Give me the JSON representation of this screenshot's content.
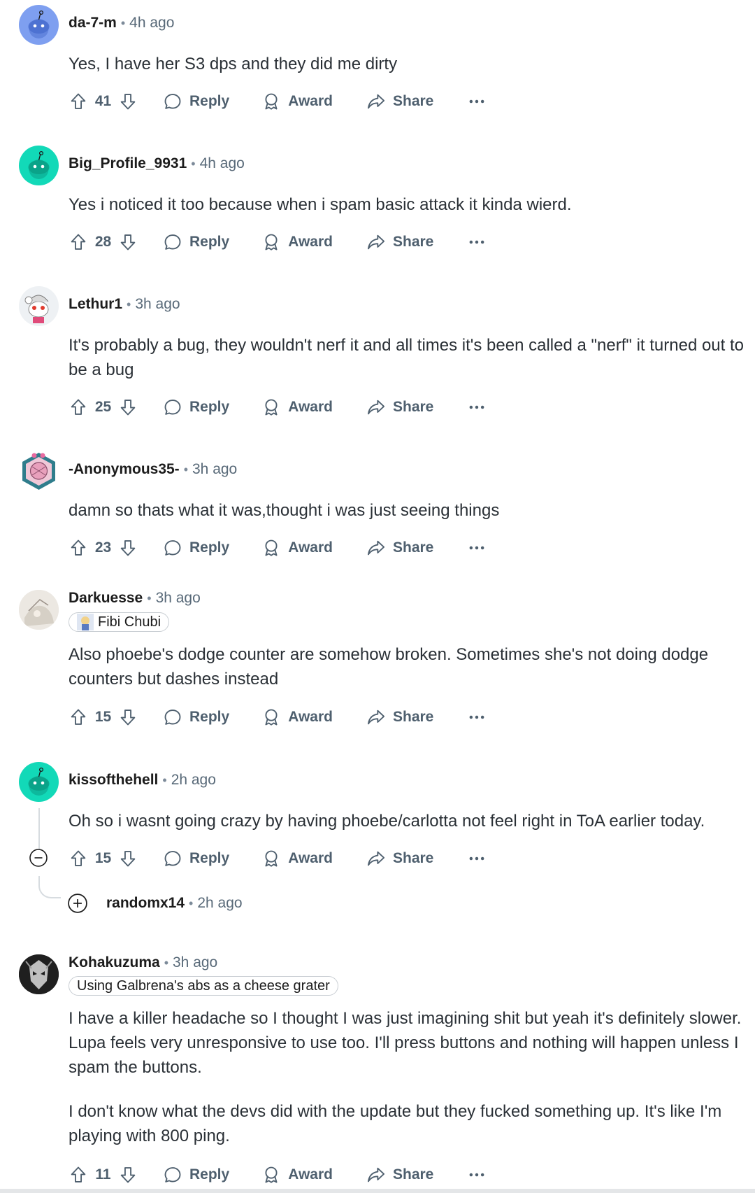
{
  "action_labels": {
    "reply": "Reply",
    "award": "Award",
    "share": "Share"
  },
  "comments": [
    {
      "author": "da-7-m",
      "time": "4h ago",
      "flair": "",
      "body": [
        "Yes, I have her S3 dps and they did me dirty"
      ],
      "votes": "41",
      "avatar": "reddit-default-blue-avatar"
    },
    {
      "author": "Big_Profile_9931",
      "time": "4h ago",
      "flair": "",
      "body": [
        "Yes i noticed it too because when i spam basic attack it kinda wierd."
      ],
      "votes": "28",
      "avatar": "reddit-default-teal-avatar"
    },
    {
      "author": "Lethur1",
      "time": "3h ago",
      "flair": "",
      "body": [
        "It's probably a bug, they wouldn't nerf it and all times it's been called a \"nerf\" it turned out to be a bug"
      ],
      "votes": "25",
      "avatar": "snoo-character-avatar"
    },
    {
      "author": "-Anonymous35-",
      "time": "3h ago",
      "flair": "",
      "body": [
        "damn so thats what it was,thought i was just seeing things"
      ],
      "votes": "23",
      "avatar": "hexagon-character-avatar"
    },
    {
      "author": "Darkuesse",
      "time": "3h ago",
      "flair": "Fibi Chubi",
      "body": [
        "Also phoebe's dodge counter are somehow broken. Sometimes she's not doing dodge counters but dashes instead"
      ],
      "votes": "15",
      "avatar": "anime-art-avatar"
    },
    {
      "author": "kissofthehell",
      "time": "2h ago",
      "flair": "",
      "body": [
        "Oh so i wasnt going crazy by having phoebe/carlotta not feel right in ToA earlier today."
      ],
      "votes": "15",
      "avatar": "reddit-default-teal-avatar",
      "collapsed_reply": {
        "author": "randomx14",
        "time": "2h ago"
      }
    },
    {
      "author": "Kohakuzuma",
      "time": "3h ago",
      "flair": "Using Galbrena's abs as a cheese grater",
      "body": [
        "I have a killer headache so I thought I was just imagining shit but yeah it's definitely slower. Lupa feels very unresponsive to use too. I'll press buttons and nothing will happen unless I spam the buttons.",
        "I don't know what the devs did with the update but they fucked something up. It's like I'm playing with 800 ping."
      ],
      "votes": "11",
      "avatar": "dark-armor-avatar"
    }
  ],
  "colors": {
    "meta_gray": "#586978",
    "teal_avatar": "#12d9b8",
    "blue_avatar": "#7e9ff0"
  }
}
